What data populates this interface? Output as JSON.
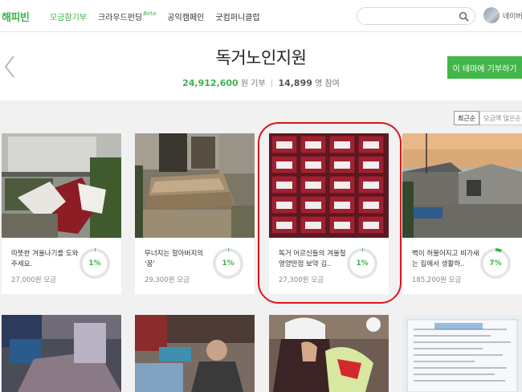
{
  "nav": {
    "logo": "해피빈",
    "items": [
      {
        "label": "모금함기부",
        "active": true
      },
      {
        "label": "크라우드펀딩",
        "active": false
      },
      {
        "label": "공익캠페인",
        "active": false
      },
      {
        "label": "굿컴퍼니클럽",
        "active": false
      }
    ],
    "beta": "Beta",
    "search_value": "",
    "user_label": "네이버"
  },
  "header": {
    "title": "독거노인지원",
    "amount": "24,912,600",
    "amount_unit": "원 기부",
    "participants": "14,899",
    "participants_unit": "명 참여",
    "cta_label": "이 테마에 기부하기"
  },
  "sort": {
    "options": [
      "최근순",
      "모금액 많은순"
    ],
    "selected": "최근순"
  },
  "cards": [
    {
      "title": "따뜻한 겨울나기를 도와주세요.",
      "amount": "27,000원 모금",
      "percent": "1%",
      "percent_value": 1
    },
    {
      "title": "무너지는 할아버지의 '꿈'",
      "amount": "29,300원 모금",
      "percent": "1%",
      "percent_value": 1
    },
    {
      "title": "독거 어르신들의 겨울철 영양만점 보약 김..",
      "amount": "27,300원 모금",
      "percent": "1%",
      "percent_value": 1
    },
    {
      "title": "벽이 허물어지고 비가새는 집에서 생활하..",
      "amount": "185,200원 모금",
      "percent": "7%",
      "percent_value": 7
    }
  ],
  "colors": {
    "brand_green": "#3db24a",
    "highlight_red": "#d9161c",
    "background": "#f1f1f1"
  }
}
